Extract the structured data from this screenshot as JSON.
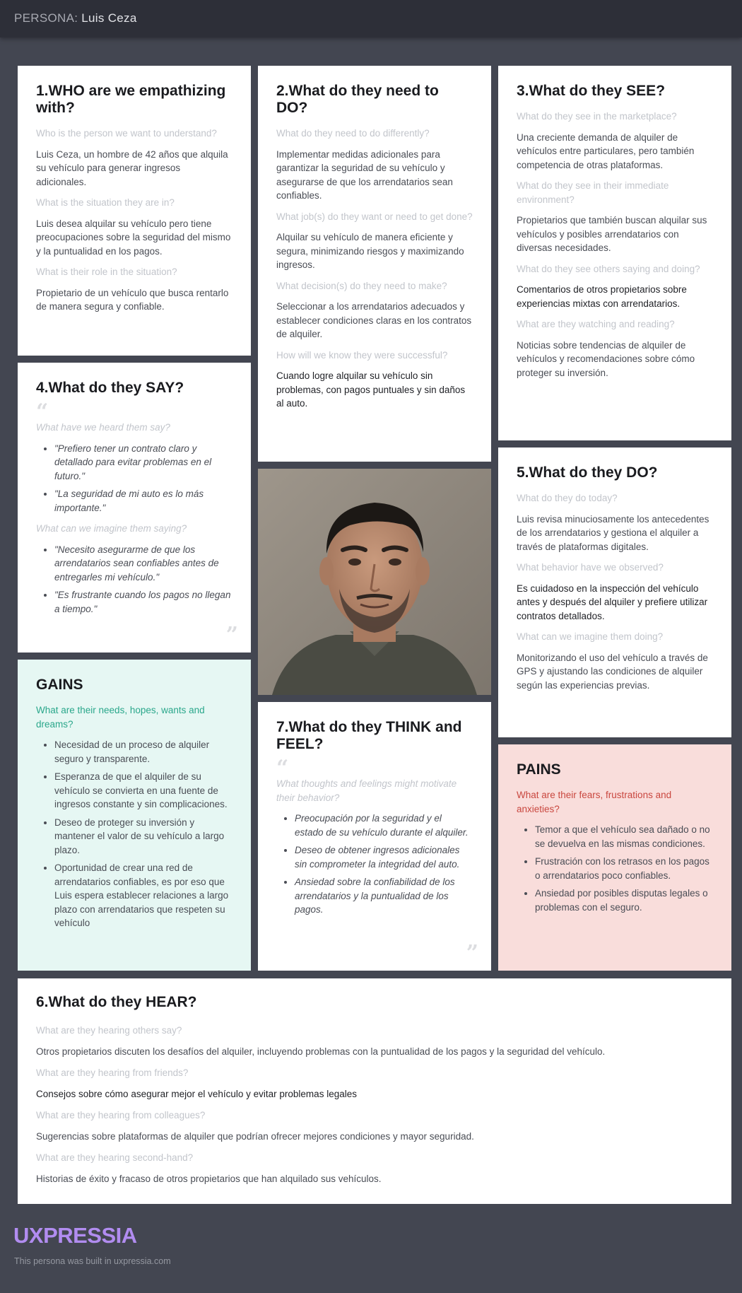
{
  "header": {
    "prefix": "PERSONA:",
    "name": "Luis Ceza"
  },
  "who": {
    "title": "1.WHO are we empathizing with?",
    "q1": "Who is the person we want to understand?",
    "a1": "Luis Ceza, un hombre de 42 años que alquila su vehículo para generar ingresos adicionales.",
    "q2": "What is the situation they are in?",
    "a2": "Luis desea alquilar su vehículo pero tiene preocupaciones sobre la seguridad del mismo y la puntualidad en los pagos.",
    "q3": "What is their role in the situation?",
    "a3": "Propietario de un vehículo que busca rentarlo de manera segura y confiable."
  },
  "do_need": {
    "title": "2.What do they need to DO?",
    "q1": "What do they need to do differently?",
    "a1": "Implementar medidas adicionales para garantizar la seguridad de su vehículo y asegurarse de que los arrendatarios sean confiables.",
    "q2": "What job(s) do they want or need to get done?",
    "a2": "Alquilar su vehículo de manera eficiente y segura, minimizando riesgos y maximizando ingresos.",
    "q3": "What decision(s) do they need to make?",
    "a3": "Seleccionar a los arrendatarios adecuados y establecer condiciones claras en los contratos de alquiler.",
    "q4": "How will we know they were successful?",
    "a4": "Cuando logre alquilar su vehículo sin problemas, con pagos puntuales y sin daños al auto."
  },
  "see": {
    "title": "3.What do they SEE?",
    "q1": "What do they see in the marketplace?",
    "a1": "Una creciente demanda de alquiler de vehículos entre particulares, pero también competencia de otras plataformas.",
    "q2": "What do they see in their immediate environment?",
    "a2": "Propietarios que también buscan alquilar sus vehículos y posibles arrendatarios con diversas necesidades.",
    "q3": "What do they see others saying and doing?",
    "a3": "Comentarios de otros propietarios sobre experiencias mixtas con arrendatarios.",
    "q4": "What are they watching and reading?",
    "a4": "Noticias sobre tendencias de alquiler de vehículos y recomendaciones sobre cómo proteger su inversión."
  },
  "say": {
    "title": "4.What do they SAY?",
    "q1": "What have we heard them say?",
    "items1": [
      "\"Prefiero tener un contrato claro y detallado para evitar problemas en el futuro.\"",
      "\"La seguridad de mi auto es lo más importante.\""
    ],
    "q2": "What can we imagine them saying?",
    "items2": [
      "\"Necesito asegurarme de que los arrendatarios sean confiables antes de entregarles mi vehículo.\"",
      "\"Es frustrante cuando los pagos no llegan a tiempo.\""
    ]
  },
  "do_today": {
    "title": "5.What do they DO?",
    "q1": "What do they do today?",
    "a1": "Luis revisa minuciosamente los antecedentes de los arrendatarios y gestiona el alquiler a través de plataformas digitales.",
    "q2": "What behavior have we observed?",
    "a2": "Es cuidadoso en la inspección del vehículo antes y después del alquiler y prefiere utilizar contratos detallados.",
    "q3": "What can we imagine them doing?",
    "a3": "Monitorizando el uso del vehículo a través de GPS y ajustando las condiciones de alquiler según las experiencias previas."
  },
  "gains": {
    "title": "GAINS",
    "q": "What are their needs, hopes, wants and dreams?",
    "items": [
      "Necesidad de un proceso de alquiler seguro y transparente.",
      "Esperanza de que el alquiler de su vehículo se convierta en una fuente de ingresos constante y sin complicaciones.",
      "Deseo de proteger su inversión y mantener el valor de su vehículo a largo plazo.",
      "Oportunidad de crear una red de arrendatarios confiables, es por eso que Luis espera establecer relaciones a largo plazo con arrendatarios que respeten su vehículo"
    ]
  },
  "think": {
    "title": "7.What do they THINK and FEEL?",
    "q": "What thoughts and feelings might motivate their behavior?",
    "items": [
      "Preocupación por la seguridad y el estado de su vehículo durante el alquiler.",
      "Deseo de obtener ingresos adicionales sin comprometer la integridad del auto.",
      "Ansiedad sobre la confiabilidad de los arrendatarios y la puntualidad de los pagos."
    ]
  },
  "pains": {
    "title": "PAINS",
    "q": "What are their fears, frustrations and anxieties?",
    "items": [
      "Temor a que el vehículo sea dañado o no se devuelva en las mismas condiciones.",
      "Frustración con los retrasos en los pagos o arrendatarios poco confiables.",
      "Ansiedad por posibles disputas legales o problemas con el seguro."
    ]
  },
  "hear": {
    "title": "6.What do they HEAR?",
    "q1": "What are they hearing others say?",
    "a1": "Otros propietarios discuten los desafíos del alquiler, incluyendo problemas con la puntualidad de los pagos y la seguridad del vehículo.",
    "q2": "What are they hearing from friends?",
    "a2": "Consejos sobre cómo asegurar mejor el vehículo y evitar problemas legales",
    "q3": "What are they hearing  from colleagues?",
    "a3": "Sugerencias sobre plataformas de alquiler que podrían ofrecer mejores condiciones y mayor seguridad.",
    "q4": "What are they hearing second-hand?",
    "a4": "Historias de éxito y fracaso de otros propietarios que han alquilado sus vehículos."
  },
  "footer": {
    "logo": "UXPRESSIA",
    "note": "This persona was built in uxpressia.com"
  },
  "colors": {
    "background": "#434651",
    "topbar": "#2d2f38",
    "gains_bg": "#e6f7f3",
    "gains_accent": "#2aa78b",
    "pains_bg": "#f9dddb",
    "pains_accent": "#c9473f",
    "logo": "#b18cf0"
  }
}
